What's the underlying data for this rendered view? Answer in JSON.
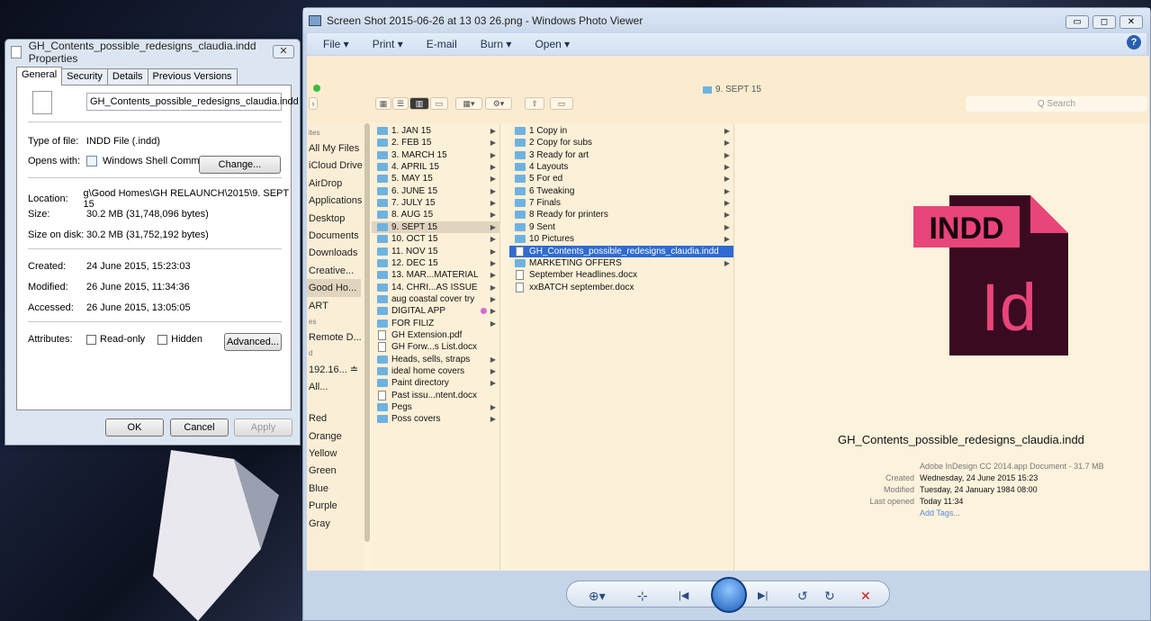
{
  "properties": {
    "title": "GH_Contents_possible_redesigns_claudia.indd Properties",
    "close": "✕",
    "tabs": [
      "General",
      "Security",
      "Details",
      "Previous Versions"
    ],
    "filename": "GH_Contents_possible_redesigns_claudia.indd",
    "type_label": "Type of file:",
    "type_value": "INDD File (.indd)",
    "opens_label": "Opens with:",
    "opens_value": "Windows Shell Commor",
    "change_button": "Change...",
    "location_label": "Location:",
    "location_value": "g\\Good Homes\\GH RELAUNCH\\2015\\9. SEPT 15",
    "size_label": "Size:",
    "size_value": "30.2 MB (31,748,096 bytes)",
    "disk_label": "Size on disk:",
    "disk_value": "30.2 MB (31,752,192 bytes)",
    "created_label": "Created:",
    "created_value": "24 June 2015, 15:23:03",
    "modified_label": "Modified:",
    "modified_value": "26 June 2015, 11:34:36",
    "accessed_label": "Accessed:",
    "accessed_value": "26 June 2015, 13:05:05",
    "attributes_label": "Attributes:",
    "readonly_label": "Read-only",
    "hidden_label": "Hidden",
    "advanced_button": "Advanced...",
    "ok": "OK",
    "cancel": "Cancel",
    "apply": "Apply"
  },
  "viewer": {
    "title": "Screen Shot 2015-06-26 at 13 03 26.png - Windows Photo Viewer",
    "menu": [
      "File ▾",
      "Print ▾",
      "E-mail",
      "Burn ▾",
      "Open ▾"
    ],
    "help": "?"
  },
  "finder": {
    "path_title": "9. SEPT 15",
    "search": "Q Search",
    "sidebar": [
      {
        "t": "ites",
        "h": true
      },
      {
        "t": "All My Files"
      },
      {
        "t": "iCloud Drive"
      },
      {
        "t": "AirDrop"
      },
      {
        "t": "Applications"
      },
      {
        "t": "Desktop"
      },
      {
        "t": "Documents"
      },
      {
        "t": "Downloads"
      },
      {
        "t": "Creative..."
      },
      {
        "t": "Good Ho..."
      },
      {
        "t": "ART"
      },
      {
        "t": "es",
        "h": true
      },
      {
        "t": "Remote D..."
      },
      {
        "t": "d",
        "h": true
      },
      {
        "t": "192.16... ≐"
      },
      {
        "t": "All..."
      },
      {
        "t": "",
        "h": true
      },
      {
        "t": "Red"
      },
      {
        "t": "Orange"
      },
      {
        "t": "Yellow"
      },
      {
        "t": "Green"
      },
      {
        "t": "Blue"
      },
      {
        "t": "Purple"
      },
      {
        "t": "Gray"
      }
    ],
    "col1": [
      {
        "t": "1. JAN 15",
        "k": "f",
        "a": 1
      },
      {
        "t": "2. FEB 15",
        "k": "f",
        "a": 1
      },
      {
        "t": "3. MARCH 15",
        "k": "f",
        "a": 1
      },
      {
        "t": "4. APRIL 15",
        "k": "f",
        "a": 1
      },
      {
        "t": "5. MAY 15",
        "k": "f",
        "a": 1
      },
      {
        "t": "6. JUNE 15",
        "k": "f",
        "a": 1
      },
      {
        "t": "7. JULY 15",
        "k": "f",
        "a": 1
      },
      {
        "t": "8. AUG 15",
        "k": "f",
        "a": 1
      },
      {
        "t": "9. SEPT 15",
        "k": "f",
        "a": 1,
        "s": 1
      },
      {
        "t": "10. OCT 15",
        "k": "f",
        "a": 1
      },
      {
        "t": "11. NOV 15",
        "k": "f",
        "a": 1
      },
      {
        "t": "12. DEC 15",
        "k": "f",
        "a": 1
      },
      {
        "t": "13. MAR...MATERIAL",
        "k": "f",
        "a": 1
      },
      {
        "t": "14. CHRI...AS ISSUE",
        "k": "f",
        "a": 1
      },
      {
        "t": "aug coastal cover try",
        "k": "f",
        "a": 1
      },
      {
        "t": "DIGITAL APP",
        "k": "f",
        "a": 1,
        "dot": 1
      },
      {
        "t": "FOR FILIZ",
        "k": "f",
        "a": 1
      },
      {
        "t": "GH Extension.pdf",
        "k": "d"
      },
      {
        "t": "GH Forw...s List.docx",
        "k": "d"
      },
      {
        "t": "Heads, sells, straps",
        "k": "f",
        "a": 1
      },
      {
        "t": "ideal home covers",
        "k": "f",
        "a": 1
      },
      {
        "t": "Paint directory",
        "k": "f",
        "a": 1
      },
      {
        "t": "Past issu...ntent.docx",
        "k": "d"
      },
      {
        "t": "Pegs",
        "k": "f",
        "a": 1
      },
      {
        "t": "Poss covers",
        "k": "f",
        "a": 1
      }
    ],
    "col2": [
      {
        "t": "1 Copy in",
        "k": "f",
        "a": 1
      },
      {
        "t": "2 Copy for subs",
        "k": "f",
        "a": 1
      },
      {
        "t": "3 Ready for art",
        "k": "f",
        "a": 1
      },
      {
        "t": "4 Layouts",
        "k": "f",
        "a": 1
      },
      {
        "t": "5 For ed",
        "k": "f",
        "a": 1
      },
      {
        "t": "6 Tweaking",
        "k": "f",
        "a": 1
      },
      {
        "t": "7 Finals",
        "k": "f",
        "a": 1
      },
      {
        "t": "8 Ready for printers",
        "k": "f",
        "a": 1
      },
      {
        "t": "9 Sent",
        "k": "f",
        "a": 1
      },
      {
        "t": "10 Pictures",
        "k": "f",
        "a": 1
      },
      {
        "t": "GH_Contents_possible_redesigns_claudia.indd",
        "k": "d",
        "h": 1
      },
      {
        "t": "MARKETING OFFERS",
        "k": "f",
        "a": 1
      },
      {
        "t": "September Headlines.docx",
        "k": "d"
      },
      {
        "t": "xxBATCH september.docx",
        "k": "d"
      }
    ],
    "preview": {
      "badge": "INDD",
      "glyph": "Id",
      "name": "GH_Contents_possible_redesigns_claudia.indd",
      "kind": "Adobe InDesign CC 2014.app Document - 31.7 MB",
      "created_label": "Created",
      "created": "Wednesday, 24 June 2015 15:23",
      "modified_label": "Modified",
      "modified": "Tuesday, 24 January 1984 08:00",
      "opened_label": "Last opened",
      "opened": "Today 11:34",
      "tags": "Add Tags..."
    }
  },
  "controls": {
    "zoom": "⊕▾",
    "fit": "⊹",
    "prev": "|◀",
    "next": "▶|",
    "rotl": "↺",
    "rotr": "↻",
    "del": "✕"
  }
}
